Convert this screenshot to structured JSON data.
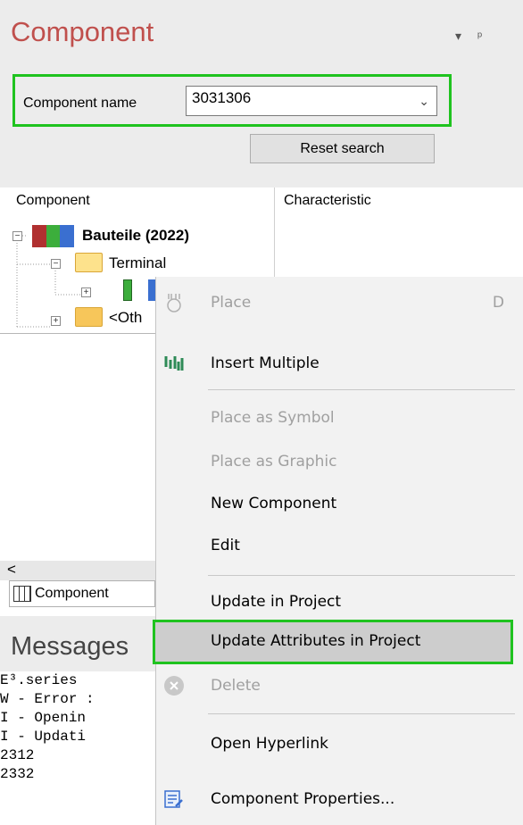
{
  "component_panel": {
    "title": "Component",
    "pin_glyphs": "▾  ⊥",
    "name_label": "Component name",
    "name_value": "3031306",
    "reset_button": "Reset search"
  },
  "tree": {
    "col_component": "Component",
    "col_characteristic": "Characteristic",
    "root_label": "Bauteile (2022)",
    "terminal_label": "Terminal",
    "other_label": "<Oth"
  },
  "bottom": {
    "tab_label": "Component",
    "scroll_left": "<",
    "messages_title": "Messages",
    "log_lines": [
      "E³.series",
      "W - Error :",
      "I - Openin",
      "I - Updati",
      "2312",
      "2332"
    ]
  },
  "context_menu": {
    "items": [
      {
        "label": "Place",
        "shortcut": "D",
        "disabled": true,
        "icon": "place-icon"
      },
      {
        "label": "Insert Multiple",
        "disabled": false,
        "icon": "insert-multiple-icon"
      },
      {
        "label": "Place as Symbol",
        "disabled": true
      },
      {
        "label": "Place as Graphic",
        "disabled": true
      },
      {
        "label": "New Component",
        "disabled": false
      },
      {
        "label": "Edit",
        "disabled": false
      },
      {
        "label": "Update in Project",
        "disabled": false
      },
      {
        "label": "Update Attributes in Project",
        "disabled": false,
        "highlighted": true
      },
      {
        "label": "Delete",
        "disabled": true,
        "icon": "delete-icon"
      },
      {
        "label": "Open Hyperlink",
        "disabled": false
      },
      {
        "label": "Component Properties...",
        "disabled": false,
        "icon": "properties-icon"
      }
    ]
  },
  "colors": {
    "accent_title": "#c0504d",
    "highlight_border": "#1fc31f"
  }
}
